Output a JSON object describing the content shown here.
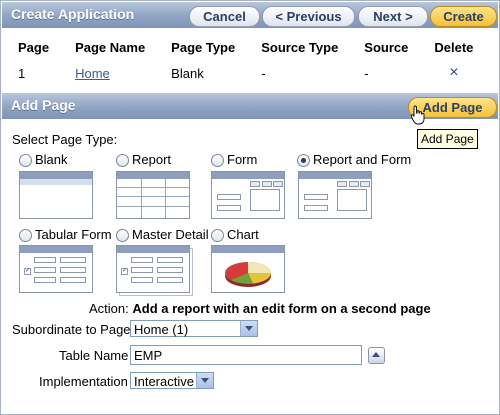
{
  "create_app": {
    "title": "Create Application",
    "buttons": {
      "cancel": "Cancel",
      "previous": "< Previous",
      "next": "Next >",
      "create": "Create"
    }
  },
  "pages_table": {
    "headers": [
      "Page",
      "Page Name",
      "Page Type",
      "Source Type",
      "Source",
      "Delete"
    ],
    "rows": [
      {
        "page": "1",
        "page_name": "Home",
        "page_type": "Blank",
        "source_type": "-",
        "source": "-",
        "delete_icon": "×"
      }
    ]
  },
  "add_page": {
    "title": "Add Page",
    "button": "Add Page",
    "tooltip": "Add Page",
    "select_type_label": "Select Page Type:",
    "types": [
      {
        "label": "Blank",
        "selected": false
      },
      {
        "label": "Report",
        "selected": false
      },
      {
        "label": "Form",
        "selected": false
      },
      {
        "label": "Report and Form",
        "selected": true
      },
      {
        "label": "Tabular Form",
        "selected": false
      },
      {
        "label": "Master Detail",
        "selected": false
      },
      {
        "label": "Chart",
        "selected": false
      }
    ],
    "action_label": "Action:",
    "action_text": "Add a report with an edit form on a second page",
    "subordinate_label": "Subordinate to Page",
    "subordinate_value": "Home (1)",
    "table_name_label": "Table Name",
    "table_name_value": "EMP",
    "implementation_label": "Implementation",
    "implementation_value": "Interactive"
  },
  "colors": {
    "bar": "#8fa3c2",
    "accent": "#f5c03a",
    "link": "#335c99"
  }
}
